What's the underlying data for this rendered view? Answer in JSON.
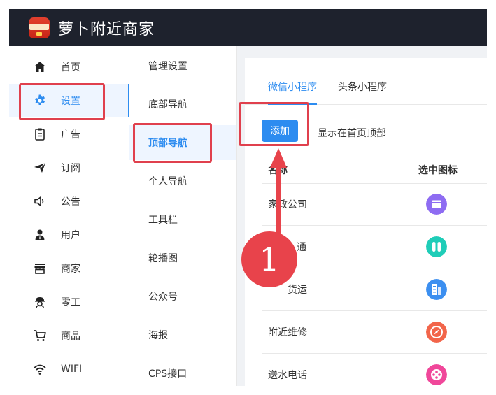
{
  "app": {
    "title": "萝卜附近商家",
    "logo_text": "附近商家"
  },
  "nav_primary": [
    {
      "label": "首页",
      "icon": "home-icon"
    },
    {
      "label": "设置",
      "icon": "gear-icon",
      "active": true
    },
    {
      "label": "广告",
      "icon": "clipboard-icon"
    },
    {
      "label": "订阅",
      "icon": "send-icon"
    },
    {
      "label": "公告",
      "icon": "speaker-icon"
    },
    {
      "label": "用户",
      "icon": "user-icon"
    },
    {
      "label": "商家",
      "icon": "store-icon"
    },
    {
      "label": "零工",
      "icon": "worker-icon"
    },
    {
      "label": "商品",
      "icon": "cart-icon"
    },
    {
      "label": "WIFI",
      "icon": "wifi-icon"
    }
  ],
  "nav_secondary": [
    {
      "label": "管理设置"
    },
    {
      "label": "底部导航"
    },
    {
      "label": "顶部导航",
      "active": true
    },
    {
      "label": "个人导航"
    },
    {
      "label": "工具栏"
    },
    {
      "label": "轮播图"
    },
    {
      "label": "公众号"
    },
    {
      "label": "海报"
    },
    {
      "label": "CPS接口"
    }
  ],
  "tabs": [
    {
      "label": "微信小程序",
      "active": true
    },
    {
      "label": "头条小程序"
    }
  ],
  "toolbar": {
    "add_label": "添加",
    "hint": "显示在首页顶部"
  },
  "table": {
    "headers": {
      "name": "名称",
      "icon": "选中图标"
    },
    "rows": [
      {
        "name": "家政公司",
        "icon": "wallet-icon",
        "color": "#8e6cf2"
      },
      {
        "name": "通",
        "icon": "pause-icon",
        "color": "#1fcdb8"
      },
      {
        "name": "货运",
        "icon": "building-icon",
        "color": "#3c8ff0"
      },
      {
        "name": "附近维修",
        "icon": "compass-icon",
        "color": "#f2654a"
      },
      {
        "name": "送水电话",
        "icon": "film-icon",
        "color": "#f0479a"
      }
    ]
  },
  "annotation": {
    "step_number": "1",
    "accent": "#e8434b"
  }
}
